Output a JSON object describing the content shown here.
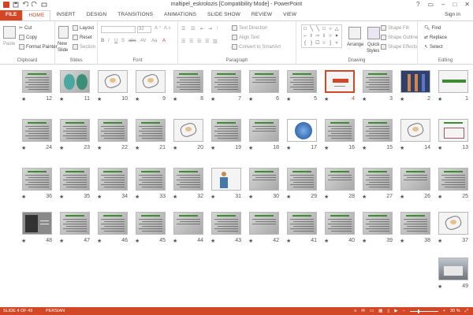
{
  "window": {
    "title": "maltipel_eskrolozis [Compatibility Mode] - PowerPoint",
    "help": "?",
    "min": "–",
    "max": "□",
    "close": "✕",
    "sign_in": "Sign in"
  },
  "tabs": [
    "FILE",
    "HOME",
    "INSERT",
    "DESIGN",
    "TRANSITIONS",
    "ANIMATIONS",
    "SLIDE SHOW",
    "REVIEW",
    "VIEW"
  ],
  "ribbon": {
    "clipboard": {
      "label": "Clipboard",
      "paste": "Paste",
      "cut": "Cut",
      "copy": "Copy",
      "format_painter": "Format Painter"
    },
    "slides": {
      "label": "Slides",
      "new_slide": "New",
      "new_slide2": "Slide",
      "layout": "Layout",
      "reset": "Reset",
      "section": "Section"
    },
    "font": {
      "label": "Font",
      "size": "32"
    },
    "paragraph": {
      "label": "Paragraph",
      "text_direction": "Text Direction",
      "align_text": "Align Text",
      "convert": "Convert to SmartArt"
    },
    "drawing": {
      "label": "Drawing",
      "arrange": "Arrange",
      "quick_styles": "Quick",
      "quick_styles2": "Styles",
      "shape_fill": "Shape Fill",
      "shape_outline": "Shape Outline",
      "shape_effects": "Shape Effects"
    },
    "editing": {
      "label": "Editing",
      "find": "Find",
      "replace": "Replace",
      "select": "Select"
    }
  },
  "slides": [
    {
      "n": "1",
      "theme": "light"
    },
    {
      "n": "2",
      "theme": "body"
    },
    {
      "n": "3",
      "theme": "text"
    },
    {
      "n": "4",
      "theme": "title",
      "selected": true
    },
    {
      "n": "5",
      "theme": "text"
    },
    {
      "n": "6",
      "theme": "gray"
    },
    {
      "n": "7",
      "theme": "text"
    },
    {
      "n": "8",
      "theme": "text"
    },
    {
      "n": "9",
      "theme": "sketch"
    },
    {
      "n": "10",
      "theme": "sketch"
    },
    {
      "n": "11",
      "theme": "brain"
    },
    {
      "n": "12",
      "theme": "text"
    },
    {
      "n": "13",
      "theme": "diagram"
    },
    {
      "n": "14",
      "theme": "sketch"
    },
    {
      "n": "15",
      "theme": "text"
    },
    {
      "n": "16",
      "theme": "text"
    },
    {
      "n": "17",
      "theme": "virus"
    },
    {
      "n": "18",
      "theme": "gray"
    },
    {
      "n": "19",
      "theme": "text"
    },
    {
      "n": "20",
      "theme": "sketch"
    },
    {
      "n": "21",
      "theme": "text"
    },
    {
      "n": "22",
      "theme": "text"
    },
    {
      "n": "23",
      "theme": "text"
    },
    {
      "n": "24",
      "theme": "text"
    },
    {
      "n": "25",
      "theme": "text"
    },
    {
      "n": "26",
      "theme": "gray"
    },
    {
      "n": "27",
      "theme": "text"
    },
    {
      "n": "28",
      "theme": "gray"
    },
    {
      "n": "29",
      "theme": "text"
    },
    {
      "n": "30",
      "theme": "gray"
    },
    {
      "n": "31",
      "theme": "figure"
    },
    {
      "n": "32",
      "theme": "text"
    },
    {
      "n": "33",
      "theme": "text"
    },
    {
      "n": "34",
      "theme": "text"
    },
    {
      "n": "35",
      "theme": "text"
    },
    {
      "n": "36",
      "theme": "text"
    },
    {
      "n": "37",
      "theme": "sketch"
    },
    {
      "n": "38",
      "theme": "text"
    },
    {
      "n": "39",
      "theme": "text"
    },
    {
      "n": "40",
      "theme": "text"
    },
    {
      "n": "41",
      "theme": "text"
    },
    {
      "n": "42",
      "theme": "gray"
    },
    {
      "n": "43",
      "theme": "text"
    },
    {
      "n": "44",
      "theme": "gray"
    },
    {
      "n": "45",
      "theme": "text"
    },
    {
      "n": "46",
      "theme": "text"
    },
    {
      "n": "47",
      "theme": "text"
    },
    {
      "n": "48",
      "theme": "photo"
    },
    {
      "n": "49",
      "theme": "photo2"
    }
  ],
  "star": "★",
  "status": {
    "slide_info": "SLIDE 4 OF 49",
    "language": "PERSIAN",
    "zoom": "30 %"
  },
  "colors": {
    "accent": "#d24726",
    "green_title": "#3c8d2f",
    "slide_bg": "#c4c4c4"
  }
}
